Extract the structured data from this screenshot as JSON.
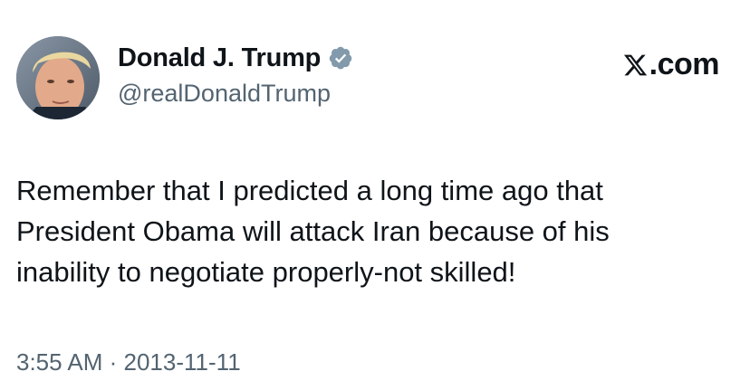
{
  "author": {
    "display_name": "Donald J. Trump",
    "handle": "@realDonaldTrump",
    "verified": true,
    "avatar_icon": "profile-photo"
  },
  "brand": {
    "label": ".com",
    "icon": "x-logo-icon"
  },
  "tweet": {
    "lines": [
      "Remember that I predicted a long time ago that",
      "President Obama will attack Iran because of his",
      "inability to negotiate properly-not skilled!"
    ]
  },
  "meta": {
    "time": "3:55 AM",
    "separator": " · ",
    "date": "2013-11-11"
  },
  "colors": {
    "text_primary": "#0f1419",
    "text_secondary": "#536471",
    "verified_badge": "#829aab",
    "background": "#ffffff"
  }
}
